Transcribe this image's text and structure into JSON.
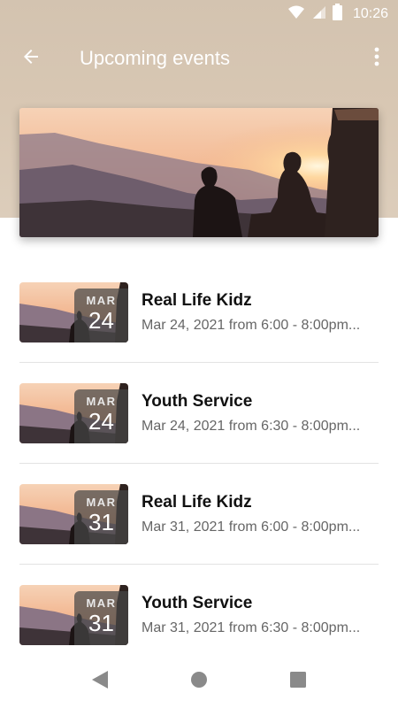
{
  "status": {
    "time": "10:26"
  },
  "app_bar": {
    "title": "Upcoming events"
  },
  "events": [
    {
      "month": "MAR",
      "day": "24",
      "title": "Real Life Kidz",
      "subtitle": "Mar 24, 2021 from 6:00 - 8:00pm..."
    },
    {
      "month": "MAR",
      "day": "24",
      "title": "Youth Service",
      "subtitle": "Mar 24, 2021 from 6:30 - 8:00pm..."
    },
    {
      "month": "MAR",
      "day": "31",
      "title": "Real Life Kidz",
      "subtitle": "Mar 31, 2021 from 6:00 - 8:00pm..."
    },
    {
      "month": "MAR",
      "day": "31",
      "title": "Youth Service",
      "subtitle": "Mar 31, 2021 from 6:30 - 8:00pm..."
    }
  ],
  "colors": {
    "header_tan": "#d6c5b1",
    "divider": "#e3e3e3",
    "badge": "#464646"
  },
  "icons": [
    "wifi-icon",
    "signal-icon",
    "battery-icon",
    "back-arrow-icon",
    "more-vert-icon",
    "nav-back-icon",
    "nav-home-icon",
    "nav-recents-icon"
  ]
}
